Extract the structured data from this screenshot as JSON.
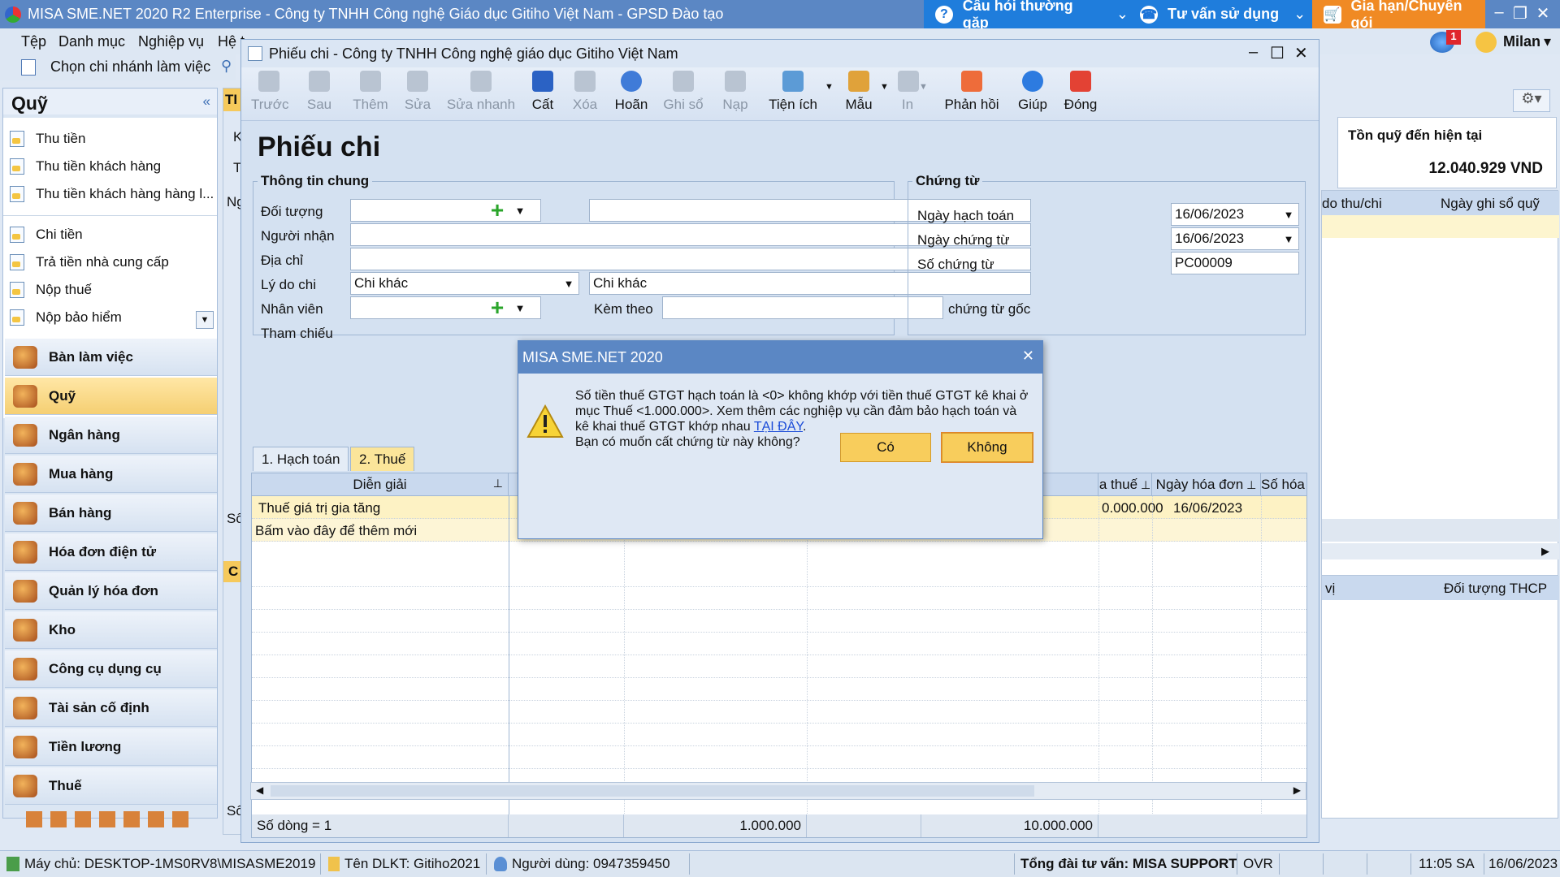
{
  "app": {
    "title": "MISA SME.NET 2020 R2 Enterprise - Công ty TNHH Công nghệ Giáo dục Gitiho Việt Nam - GPSD Đào tạo",
    "top_buttons": [
      {
        "label": "Câu hỏi thường gặp"
      },
      {
        "label": "Tư vấn sử dụng"
      },
      {
        "label": "Gia hạn/Chuyển gói"
      }
    ],
    "accent": "#5b87c4"
  },
  "menu": {
    "items": [
      "Tệp",
      "Danh mục",
      "Nghiệp vụ",
      "Hệ t"
    ],
    "branch_label": "Chọn chi nhánh làm việc"
  },
  "user": {
    "name": "Milan",
    "notifications": "1"
  },
  "sidebar": {
    "title": "Quỹ",
    "items": [
      "Thu tiền",
      "Thu tiền khách hàng",
      "Thu tiền khách hàng hàng l...",
      "Chi tiền",
      "Trả tiền nhà cung cấp",
      "Nộp thuế",
      "Nộp bảo hiểm"
    ],
    "modules": [
      "Bàn làm việc",
      "Quỹ",
      "Ngân hàng",
      "Mua hàng",
      "Bán hàng",
      "Hóa đơn điện tử",
      "Quản lý hóa đơn",
      "Kho",
      "Công cụ dụng cụ",
      "Tài sản cố định",
      "Tiền lương",
      "Thuế"
    ]
  },
  "background": {
    "tab_partial": "TI",
    "fund_label": "Tồn quỹ đến hiện tại",
    "fund_value": "12.040.929 VND",
    "col1": "do thu/chi",
    "col2": "Ngày ghi sổ quỹ",
    "col3": "vị",
    "col4": "Đối tượng THCP",
    "frag_k": "K",
    "frag_t": "T",
    "frag_ng": "Ng",
    "frag_so1": "Số",
    "frag_c": "C",
    "frag_so2": "Số"
  },
  "window": {
    "title": "Phiếu chi - Công ty TNHH Công nghệ giáo dục Gitiho Việt Nam",
    "toolbar": [
      "Trước",
      "Sau",
      "Thêm",
      "Sửa",
      "Sửa nhanh",
      "Cất",
      "Xóa",
      "Hoãn",
      "Ghi sổ",
      "Nạp",
      "Tiện ích",
      "Mẫu",
      "In",
      "Phản hồi",
      "Giúp",
      "Đóng"
    ]
  },
  "form": {
    "heading": "Phiếu chi",
    "general": {
      "legend": "Thông tin chung",
      "doi_tuong": "Đối tượng",
      "nguoi_nhan": "Người nhận",
      "dia_chi": "Địa chỉ",
      "ly_do_chi": "Lý do chi",
      "ly_do_value": "Chi khác",
      "ly_do_text": "Chi khác",
      "nhan_vien": "Nhân viên",
      "kem_theo": "Kèm theo",
      "chung_tu_goc": "chứng từ gốc",
      "tham_chieu": "Tham chiếu"
    },
    "doc": {
      "legend": "Chứng từ",
      "ngay_hach_toan": "Ngày hạch toán",
      "ngay_hach_toan_value": "16/06/2023",
      "ngay_chung_tu": "Ngày chứng từ",
      "ngay_chung_tu_value": "16/06/2023",
      "so_chung_tu": "Số chứng từ",
      "so_chung_tu_value": "PC00009"
    },
    "tabs": [
      "1. Hạch toán",
      "2. Thuế"
    ],
    "grid": {
      "columns": [
        "Diễn giải",
        "a thuế",
        "Ngày hóa đơn",
        "Số hóa đơ"
      ],
      "rows": [
        {
          "dien_giai": "Thuế giá trị gia tăng",
          "amount": "0.000.000",
          "date": "16/06/2023"
        },
        {
          "dien_giai": "Bấm vào đây để thêm mới"
        }
      ],
      "footer": {
        "count": "Số dòng = 1",
        "sum1": "1.000.000",
        "sum2": "10.000.000"
      }
    }
  },
  "dialog": {
    "title": "MISA SME.NET 2020",
    "line1": "Số tiền thuế GTGT hạch toán là <0> không khớp với tiền thuế GTGT kê khai ở",
    "line2": "mục Thuế <1.000.000>. Xem thêm các nghiệp vụ cần đảm bảo hạch toán và",
    "line3_pre": "kê khai thuế GTGT khớp nhau ",
    "link": "TẠI ĐÂY",
    "line3_post": ".",
    "line4": "Bạn có muốn cất chứng từ này không?",
    "yes": "Có",
    "no": "Không"
  },
  "status": {
    "server": "Máy chủ: DESKTOP-1MS0RV8\\MISASME2019",
    "db": "Tên DLKT: Gitiho2021",
    "user": "Người dùng: 0947359450",
    "support": "Tổng đài tư vấn: MISA SUPPORT",
    "ovr": "OVR",
    "time": "11:05 SA",
    "date": "16/06/2023"
  }
}
